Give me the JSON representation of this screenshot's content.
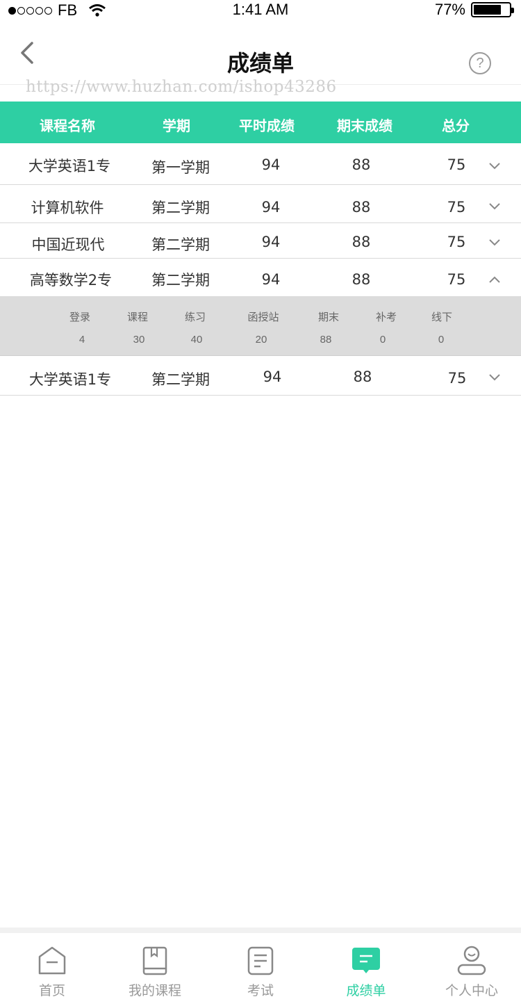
{
  "status_bar": {
    "carrier": "FB",
    "time": "1:41 AM",
    "battery": "77%",
    "battery_level": 0.77
  },
  "nav": {
    "title": "成绩单",
    "back_icon": "chevron-left-icon",
    "help_icon": "question-circle-icon",
    "help_label": "?"
  },
  "watermark": "https://www.huzhan.com/ishop43286",
  "table": {
    "headers": [
      "课程名称",
      "学期",
      "平时成绩",
      "期末成绩",
      "总分"
    ],
    "rows": [
      {
        "course": "大学英语1专",
        "term": "第一学期",
        "regular": "94",
        "final": "88",
        "total": "75",
        "expanded": false
      },
      {
        "course": "计算机软件",
        "term": "第二学期",
        "regular": "94",
        "final": "88",
        "total": "75",
        "expanded": false
      },
      {
        "course": "中国近现代",
        "term": "第二学期",
        "regular": "94",
        "final": "88",
        "total": "75",
        "expanded": false
      },
      {
        "course": "高等数学2专",
        "term": "第二学期",
        "regular": "94",
        "final": "88",
        "total": "75",
        "expanded": true
      },
      {
        "course": "大学英语1专",
        "term": "第二学期",
        "regular": "94",
        "final": "88",
        "total": "75",
        "expanded": false
      }
    ],
    "detail": {
      "labels": [
        "登录",
        "课程",
        "练习",
        "函授站",
        "期末",
        "补考",
        "线下"
      ],
      "values": [
        "4",
        "30",
        "40",
        "20",
        "88",
        "0",
        "0"
      ]
    }
  },
  "tab_bar": {
    "tabs": [
      {
        "label": "首页",
        "icon": "home-icon",
        "active": false
      },
      {
        "label": "我的课程",
        "icon": "book-icon",
        "active": false
      },
      {
        "label": "考试",
        "icon": "exam-paper-icon",
        "active": false
      },
      {
        "label": "成绩单",
        "icon": "transcript-icon",
        "active": true
      },
      {
        "label": "个人中心",
        "icon": "user-icon",
        "active": false
      }
    ]
  },
  "colors": {
    "accent": "#2ecfa3",
    "header_text": "#ffffff",
    "detail_bg": "#dcdcdc",
    "tab_inactive": "#999999"
  }
}
